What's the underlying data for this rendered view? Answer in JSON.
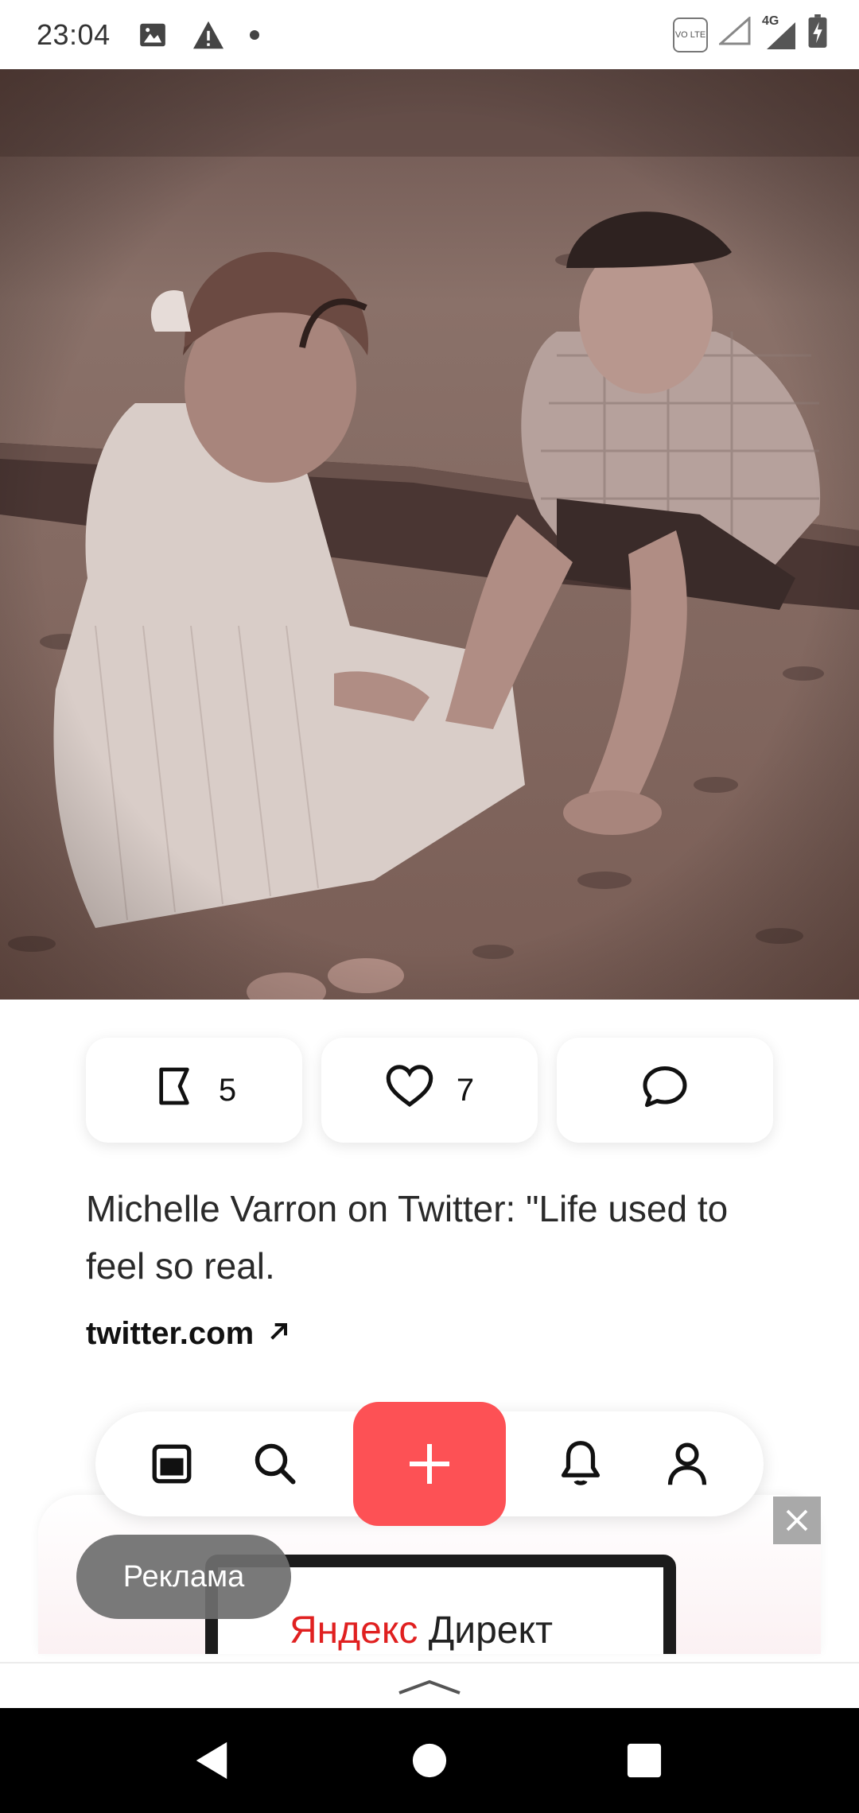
{
  "status_bar": {
    "time": "23:04",
    "left_icons": [
      "image-icon",
      "warning-icon",
      "dot-icon"
    ],
    "right_icons": [
      "volte-icon",
      "signal-empty-icon",
      "signal-4g-icon",
      "battery-charging-icon"
    ],
    "network_label": "4G",
    "volte_label": "VO LTE"
  },
  "post": {
    "actions": [
      {
        "icon": "bookmark-icon",
        "count": "5"
      },
      {
        "icon": "heart-icon",
        "count": "7"
      },
      {
        "icon": "comment-icon",
        "count": ""
      }
    ],
    "title": "Michelle Varron on Twitter: \"Life used to feel so real.",
    "source": "twitter.com"
  },
  "bottom_nav": {
    "items": [
      "feed-icon",
      "search-icon",
      "add-icon",
      "bell-icon",
      "profile-icon"
    ]
  },
  "ad": {
    "badge": "Реклама",
    "brand_red": "Яндекс",
    "brand_dark": "Директ"
  },
  "colors": {
    "accent": "#fd5155",
    "system_nav": "#000000"
  }
}
